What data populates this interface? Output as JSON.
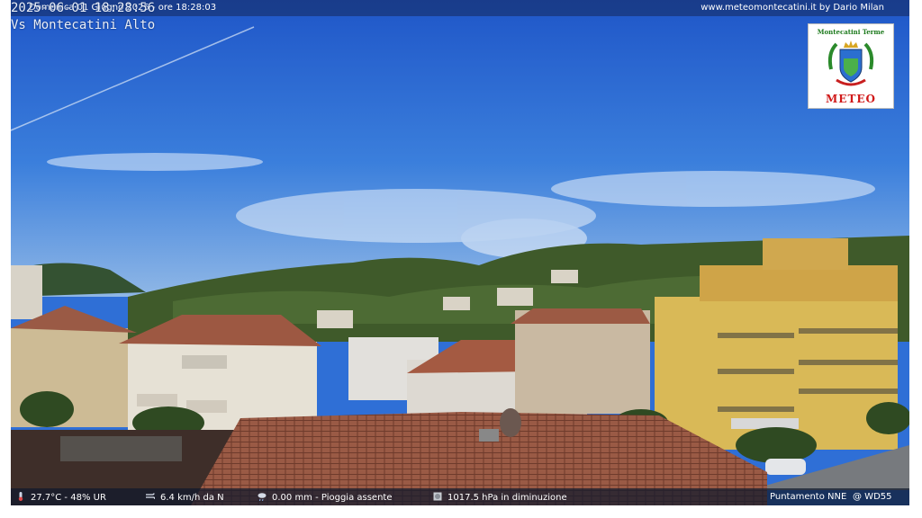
{
  "overlay": {
    "datetime": "Domenica 01 Giugno 2025 - ore 18:28:03",
    "credit": "www.meteomontecatini.it by Dario Milan",
    "timestamp": "2025-06-01 18:28:56",
    "camera_name": "Vs Montecatini Alto"
  },
  "logo": {
    "title": "Montecatini Terme",
    "subtitle": "METEO"
  },
  "status": {
    "temperature_humidity": "27.7°C - 48% UR",
    "wind": "6.4 km/h da N",
    "rain": "0.00 mm - Pioggia assente",
    "pressure": "1017.5 hPa in diminuzione",
    "pointing": "Puntamento NNE",
    "camera_model": "@ WD55"
  },
  "icons": [
    "thermometer-icon",
    "wind-icon",
    "rain-cloud-icon",
    "barometer-icon"
  ],
  "colors": {
    "sky": "#2f6fd6",
    "roof": "#9a5a45",
    "foliage": "#3f5a2a",
    "logo_red": "#d01818",
    "logo_green": "#1d7a1d"
  }
}
